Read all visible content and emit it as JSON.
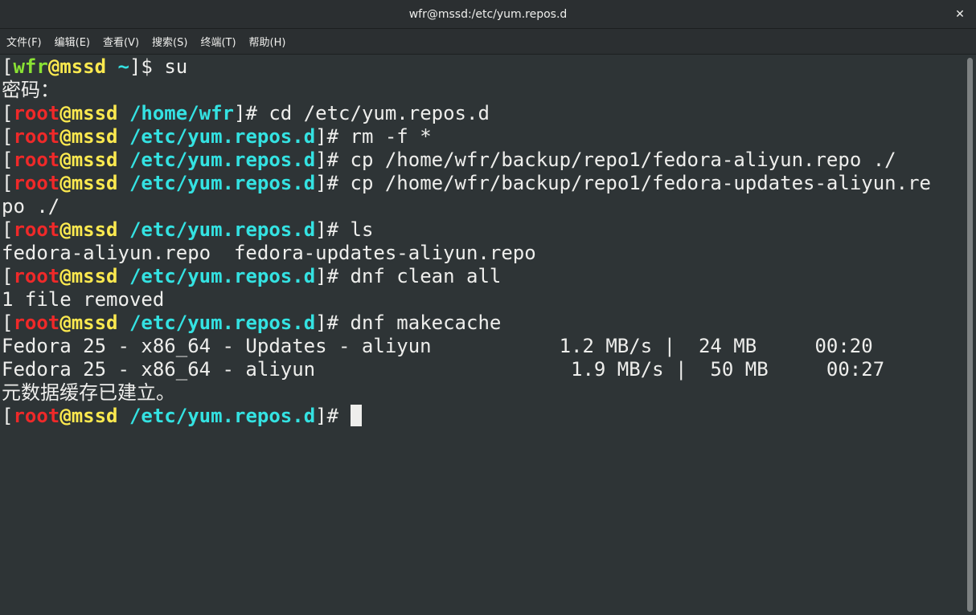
{
  "window": {
    "title": "wfr@mssd:/etc/yum.repos.d",
    "close_glyph": "✕"
  },
  "menu": [
    {
      "label": "文件(F)"
    },
    {
      "label": "编辑(E)"
    },
    {
      "label": "查看(V)"
    },
    {
      "label": "搜索(S)"
    },
    {
      "label": "终端(T)"
    },
    {
      "label": "帮助(H)"
    }
  ],
  "colors": {
    "background": "#2e3436",
    "foreground": "#eeeeec",
    "user_green": "#8ae234",
    "root_red": "#ef2929",
    "host_yellow": "#fce94f",
    "path_cyan": "#34e2e2"
  },
  "terminal": {
    "lines": [
      {
        "type": "prompt",
        "user": "wfr",
        "role": "user",
        "host": "mssd",
        "path": "~",
        "symbol": "$",
        "command": "su"
      },
      {
        "type": "text",
        "text": "密码："
      },
      {
        "type": "prompt",
        "user": "root",
        "role": "root",
        "host": "mssd",
        "path": "/home/wfr",
        "symbol": "#",
        "command": "cd /etc/yum.repos.d"
      },
      {
        "type": "prompt",
        "user": "root",
        "role": "root",
        "host": "mssd",
        "path": "/etc/yum.repos.d",
        "symbol": "#",
        "command": "rm -f *"
      },
      {
        "type": "prompt",
        "user": "root",
        "role": "root",
        "host": "mssd",
        "path": "/etc/yum.repos.d",
        "symbol": "#",
        "command": "cp /home/wfr/backup/repo1/fedora-aliyun.repo ./"
      },
      {
        "type": "prompt",
        "user": "root",
        "role": "root",
        "host": "mssd",
        "path": "/etc/yum.repos.d",
        "symbol": "#",
        "command": "cp /home/wfr/backup/repo1/fedora-updates-aliyun.re"
      },
      {
        "type": "text",
        "text": "po ./"
      },
      {
        "type": "prompt",
        "user": "root",
        "role": "root",
        "host": "mssd",
        "path": "/etc/yum.repos.d",
        "symbol": "#",
        "command": "ls"
      },
      {
        "type": "text",
        "text": "fedora-aliyun.repo  fedora-updates-aliyun.repo"
      },
      {
        "type": "prompt",
        "user": "root",
        "role": "root",
        "host": "mssd",
        "path": "/etc/yum.repos.d",
        "symbol": "#",
        "command": "dnf clean all"
      },
      {
        "type": "text",
        "text": "1 file removed"
      },
      {
        "type": "prompt",
        "user": "root",
        "role": "root",
        "host": "mssd",
        "path": "/etc/yum.repos.d",
        "symbol": "#",
        "command": "dnf makecache"
      },
      {
        "type": "text",
        "text": "Fedora 25 - x86_64 - Updates - aliyun           1.2 MB/s |  24 MB     00:20"
      },
      {
        "type": "text",
        "text": "Fedora 25 - x86_64 - aliyun                      1.9 MB/s |  50 MB     00:27"
      },
      {
        "type": "text",
        "text": "元数据缓存已建立。"
      },
      {
        "type": "prompt",
        "user": "root",
        "role": "root",
        "host": "mssd",
        "path": "/etc/yum.repos.d",
        "symbol": "#",
        "command": "",
        "cursor": true
      }
    ]
  }
}
